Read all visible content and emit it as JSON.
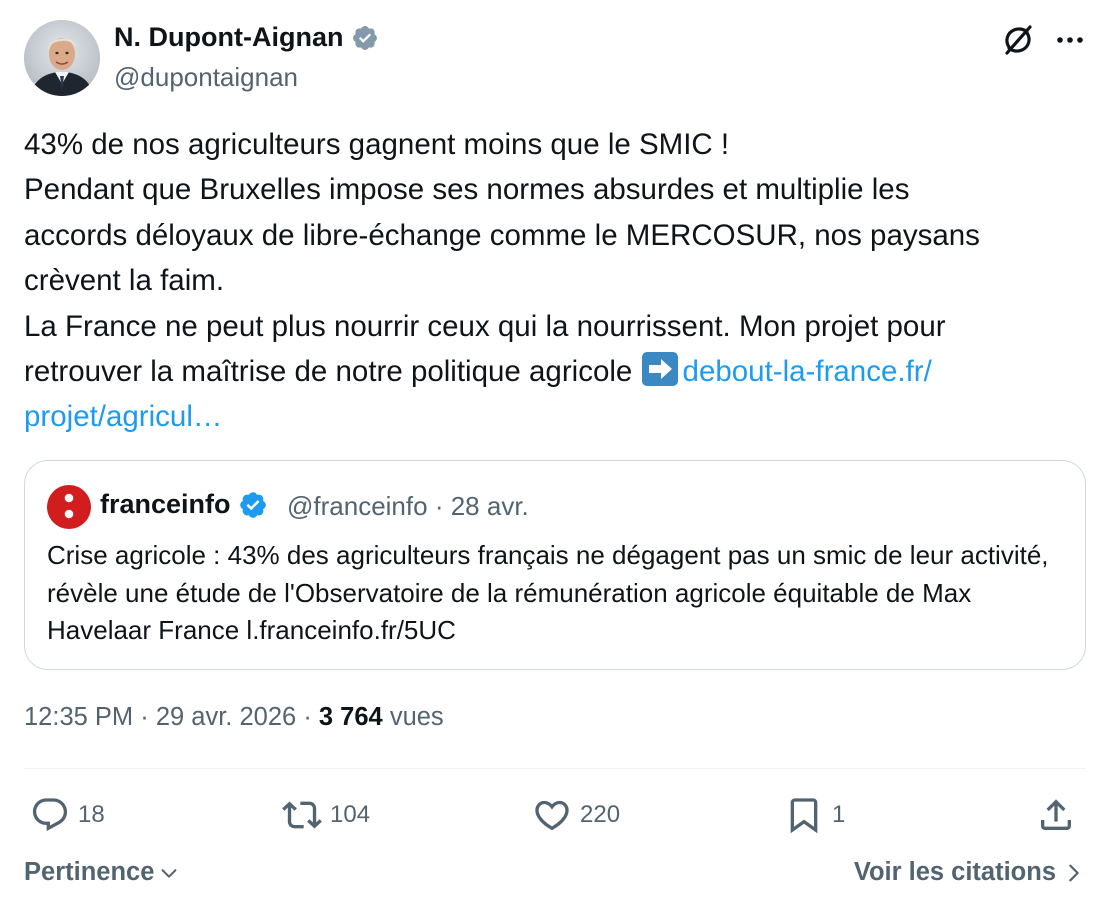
{
  "author": {
    "name": "N. Dupont-Aignan",
    "handle": "@dupontaignan",
    "verified": true
  },
  "tweet": {
    "lines": [
      "43% de nos agriculteurs gagnent moins que le SMIC !",
      "Pendant que Bruxelles impose ses normes absurdes et multiplie les",
      "accords déloyaux de libre-échange comme le MERCOSUR, nos paysans",
      "crèvent la faim.",
      "La France ne peut plus nourrir ceux qui la nourrissent. Mon projet pour"
    ],
    "last_line_text": "retrouver la maîtrise de notre politique agricole ",
    "link_part1": "debout-la-france.fr/",
    "link_part2": "projet/agricul…",
    "arrow_icon": "right-arrow-emoji"
  },
  "quote": {
    "name": "franceinfo",
    "handle": "@franceinfo",
    "separator": "·",
    "date": "28 avr.",
    "text": "Crise agricole : 43% des agriculteurs français ne dégagent pas un smic de leur activité, révèle une étude de l'Observatoire de la rémunération agricole équitable de Max Havelaar France l.franceinfo.fr/5UC",
    "brand_color": "#d11d1d"
  },
  "meta": {
    "time": "12:35 PM",
    "date": "29 avr. 2026",
    "separator": "·",
    "views_count": "3 764",
    "views_label": "vues"
  },
  "actions": {
    "replies": "18",
    "reposts": "104",
    "likes": "220",
    "bookmarks": "1"
  },
  "footer": {
    "sort_label": "Pertinence",
    "quotes_label": "Voir les citations"
  },
  "colors": {
    "link": "#1d9bf0",
    "secondary_text": "#536471",
    "verified": "#1d9bf0",
    "border": "#cfd9de"
  }
}
